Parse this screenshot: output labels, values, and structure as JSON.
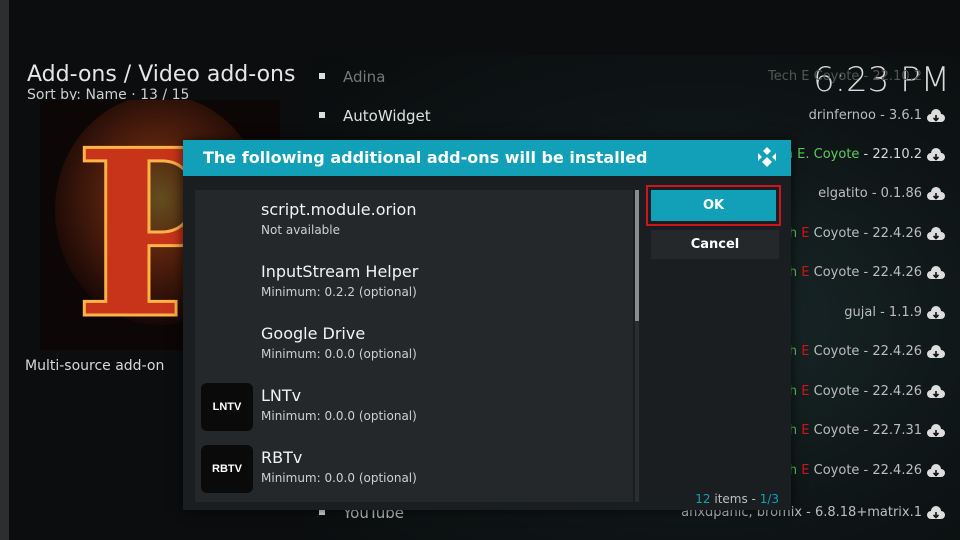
{
  "header": {
    "title": "Add-ons / Video add-ons",
    "sort_label": "Sort by: Name",
    "separator": "·",
    "position": "13 / 15"
  },
  "clock": "6:23 PM",
  "left_panel": {
    "description": "Multi-source add-on",
    "fanart_letter": "P"
  },
  "list": [
    {
      "name": "Adina",
      "meta_pre": "",
      "meta_accent": "",
      "meta_post": "Tech E Coyote - 22.10.2"
    },
    {
      "name": "AutoWidget",
      "meta_pre": "",
      "meta_accent": "",
      "meta_post": "drinfernoo - 3.6.1"
    },
    {
      "name": "",
      "meta_pre": "ech E. Coyote",
      "meta_accent": "",
      "meta_post": " - 22.10.2"
    },
    {
      "name": "",
      "meta_pre": "",
      "meta_accent": "",
      "meta_post": "elgatito - 0.1.86"
    },
    {
      "name": "",
      "meta_pre": "ch ",
      "meta_accent": "E",
      "meta_post": " Coyote - 22.4.26"
    },
    {
      "name": "",
      "meta_pre": "ch ",
      "meta_accent": "E",
      "meta_post": " Coyote - 22.4.26"
    },
    {
      "name": "",
      "meta_pre": "",
      "meta_accent": "",
      "meta_post": "gujal - 1.1.9"
    },
    {
      "name": "",
      "meta_pre": "ch ",
      "meta_accent": "E",
      "meta_post": " Coyote - 22.4.26"
    },
    {
      "name": "",
      "meta_pre": "ch ",
      "meta_accent": "E",
      "meta_post": " Coyote - 22.4.26"
    },
    {
      "name": "",
      "meta_pre": "ch ",
      "meta_accent": "E",
      "meta_post": " Coyote - 22.7.31"
    },
    {
      "name": "",
      "meta_pre": "ch ",
      "meta_accent": "E",
      "meta_post": " Coyote - 22.4.26"
    },
    {
      "name": "YouTube",
      "meta_pre": "",
      "meta_accent": "",
      "meta_post": "anxdpanic, bromix - 6.8.18+matrix.1"
    }
  ],
  "dialog": {
    "title": "The following additional add-ons will be installed",
    "items": [
      {
        "name": "script.module.orion",
        "detail": "Not available",
        "thumb": ""
      },
      {
        "name": "InputStream Helper",
        "detail": "Minimum: 0.2.2 (optional)",
        "thumb": ""
      },
      {
        "name": "Google Drive",
        "detail": "Minimum: 0.0.0 (optional)",
        "thumb": ""
      },
      {
        "name": "LNTv",
        "detail": "Minimum: 0.0.0 (optional)",
        "thumb": "LNTV"
      },
      {
        "name": "RBTv",
        "detail": "Minimum: 0.0.0 (optional)",
        "thumb": "RBTV"
      }
    ],
    "ok_label": "OK",
    "cancel_label": "Cancel",
    "count_items": "12",
    "count_suffix": " items - ",
    "count_page": "1/3"
  },
  "colors": {
    "accent": "#12a0b8",
    "highlight_border": "#d0141c",
    "green_text": "#5ecb5e"
  },
  "icons": {
    "row_action": "cloud-download-icon",
    "dialog_logo": "kodi-logo-icon"
  }
}
